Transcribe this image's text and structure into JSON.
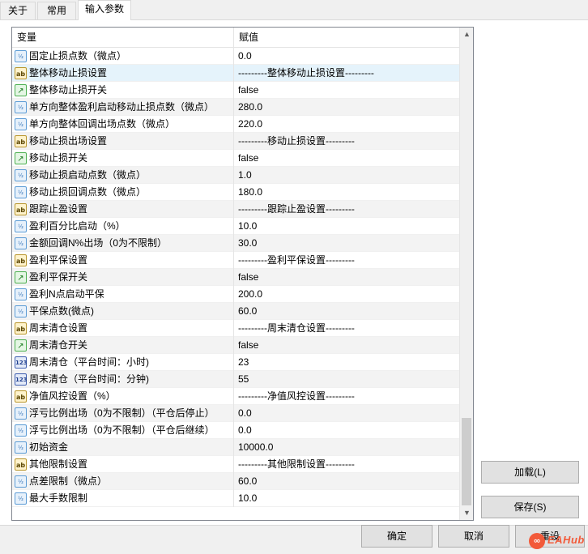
{
  "tabs": [
    {
      "label": "关于",
      "active": false
    },
    {
      "label": "常用",
      "active": false
    },
    {
      "label": "输入参数",
      "active": true
    }
  ],
  "grid": {
    "columns": {
      "variable": "变量",
      "value": "赋值"
    },
    "rows": [
      {
        "icon": "double",
        "name": "固定止损点数（微点）",
        "value": "0.0"
      },
      {
        "icon": "string",
        "name": "整体移动止损设置",
        "value": "---------整体移动止损设置---------",
        "selected": true
      },
      {
        "icon": "bool",
        "name": "整体移动止损开关",
        "value": "false"
      },
      {
        "icon": "double",
        "name": "单方向整体盈利启动移动止损点数（微点）",
        "value": "280.0"
      },
      {
        "icon": "double",
        "name": "单方向整体回调出场点数（微点）",
        "value": "220.0"
      },
      {
        "icon": "string",
        "name": "移动止损出场设置",
        "value": "---------移动止损设置---------"
      },
      {
        "icon": "bool",
        "name": "移动止损开关",
        "value": "false"
      },
      {
        "icon": "double",
        "name": "移动止损启动点数（微点）",
        "value": "1.0"
      },
      {
        "icon": "double",
        "name": "移动止损回调点数（微点）",
        "value": "180.0"
      },
      {
        "icon": "string",
        "name": "跟踪止盈设置",
        "value": "---------跟踪止盈设置---------"
      },
      {
        "icon": "double",
        "name": "盈利百分比启动（%）",
        "value": "10.0"
      },
      {
        "icon": "double",
        "name": "金额回调N%出场（0为不限制）",
        "value": "30.0"
      },
      {
        "icon": "string",
        "name": "盈利平保设置",
        "value": "---------盈利平保设置---------"
      },
      {
        "icon": "bool",
        "name": "盈利平保开关",
        "value": "false"
      },
      {
        "icon": "double",
        "name": "盈利N点启动平保",
        "value": "200.0"
      },
      {
        "icon": "double",
        "name": "平保点数(微点)",
        "value": "60.0"
      },
      {
        "icon": "string",
        "name": "周末清仓设置",
        "value": "---------周末清仓设置---------"
      },
      {
        "icon": "bool",
        "name": "周末清仓开关",
        "value": "false"
      },
      {
        "icon": "int",
        "name": "周末清仓（平台时间：小时)",
        "value": "23"
      },
      {
        "icon": "int",
        "name": "周末清仓（平台时间：分钟)",
        "value": "55"
      },
      {
        "icon": "string",
        "name": "净值风控设置（%）",
        "value": "---------净值风控设置---------"
      },
      {
        "icon": "double",
        "name": "浮亏比例出场（0为不限制）（平仓后停止）",
        "value": "0.0"
      },
      {
        "icon": "double",
        "name": "浮亏比例出场（0为不限制）（平仓后继续）",
        "value": "0.0"
      },
      {
        "icon": "double",
        "name": "初始资金",
        "value": "10000.0"
      },
      {
        "icon": "string",
        "name": "其他限制设置",
        "value": "---------其他限制设置---------"
      },
      {
        "icon": "double",
        "name": "点差限制（微点）",
        "value": "60.0"
      },
      {
        "icon": "double",
        "name": "最大手数限制",
        "value": "10.0"
      }
    ]
  },
  "icons": {
    "double": {
      "glyph": "½",
      "name": "double-type-icon"
    },
    "string": {
      "glyph": "ab",
      "name": "string-type-icon"
    },
    "bool": {
      "glyph": "↗",
      "name": "bool-type-icon"
    },
    "int": {
      "glyph": "123",
      "name": "integer-type-icon"
    }
  },
  "scrollbar": {
    "up": "▲",
    "down": "▼",
    "position": "bottom"
  },
  "side_buttons": {
    "load": "加载(L)",
    "save": "保存(S)"
  },
  "footer_buttons": {
    "ok": "确定",
    "cancel": "取消",
    "reset": "重设"
  },
  "watermark": {
    "brand": "EAHub",
    "glyph": "∞"
  },
  "colors": {
    "selected_row": "#e5f3fb",
    "alt_row": "#f3f3f3",
    "watermark": "#f25a3a"
  }
}
